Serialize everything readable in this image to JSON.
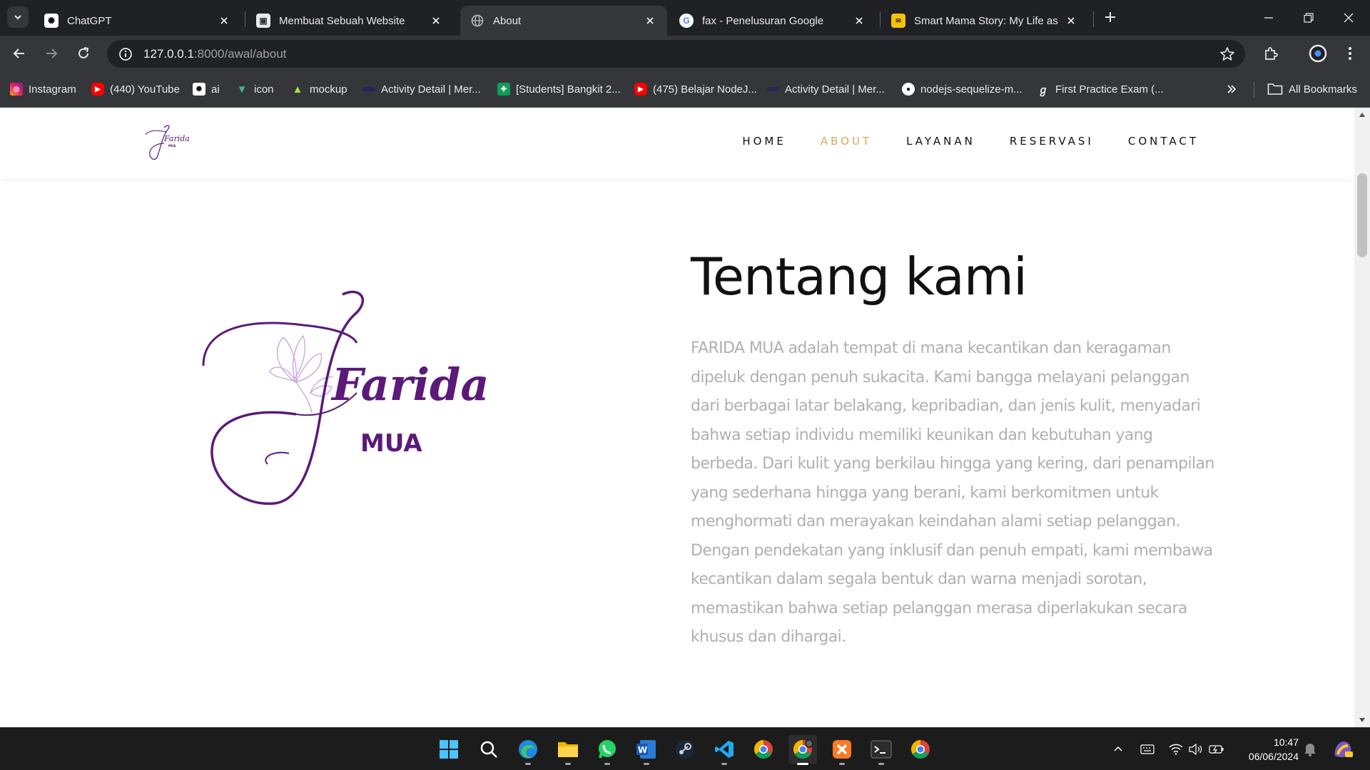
{
  "browser": {
    "tabs": [
      {
        "title": "ChatGPT",
        "icon": "chatgpt-icon"
      },
      {
        "title": "Membuat Sebuah Website",
        "icon": "classroom-icon"
      },
      {
        "title": "About",
        "icon": "globe-icon",
        "active": true
      },
      {
        "title": "fax - Penelusuran Google",
        "icon": "google-icon"
      },
      {
        "title": "Smart Mama Story: My Life as a",
        "icon": "blog-icon"
      }
    ],
    "url_host": "127.0.0.1",
    "url_path": ":8000/awal/about",
    "bookmarks": [
      {
        "label": "Instagram",
        "icon": "instagram-icon"
      },
      {
        "label": "(440) YouTube",
        "icon": "youtube-icon"
      },
      {
        "label": "ai",
        "icon": "chatgpt-icon"
      },
      {
        "label": "icon",
        "icon": "vue-icon"
      },
      {
        "label": "mockup",
        "icon": "mockup-icon"
      },
      {
        "label": "Activity Detail | Mer...",
        "icon": "activity-icon"
      },
      {
        "label": "[Students] Bangkit 2...",
        "icon": "sheets-icon"
      },
      {
        "label": "(475) Belajar NodeJ...",
        "icon": "youtube-icon"
      },
      {
        "label": "Activity Detail | Mer...",
        "icon": "activity-icon"
      },
      {
        "label": "nodejs-sequelize-m...",
        "icon": "github-icon"
      },
      {
        "label": "First Practice Exam (...",
        "icon": "exam-icon"
      }
    ],
    "all_bookmarks": "All Bookmarks"
  },
  "site": {
    "logo_script": "Farida",
    "logo_sub": "MUA",
    "nav": [
      {
        "label": "HOME",
        "active": false
      },
      {
        "label": "ABOUT",
        "active": true
      },
      {
        "label": "LAYANAN",
        "active": false
      },
      {
        "label": "RESERVASI",
        "active": false
      },
      {
        "label": "CONTACT",
        "active": false
      }
    ],
    "about_title": "Tentang kami",
    "about_text": "FARIDA MUA adalah tempat di mana kecantikan dan keragaman dipeluk dengan penuh sukacita. Kami bangga melayani pelanggan dari berbagai latar belakang, kepribadian, dan jenis kulit, menyadari bahwa setiap individu memiliki keunikan dan kebutuhan yang berbeda. Dari kulit yang berkilau hingga yang kering, dari penampilan yang sederhana hingga yang berani, kami berkomitmen untuk menghormati dan merayakan keindahan alami setiap pelanggan. Dengan pendekatan yang inklusif dan penuh empati, kami membawa kecantikan dalam segala bentuk dan warna menjadi sorotan, memastikan bahwa setiap pelanggan merasa diperlakukan secara khusus dan dihargai."
  },
  "colors": {
    "accent_nav": "#d6a85c",
    "logo_purple": "#5b1a7a",
    "flower_lilac": "#c9a0dc"
  },
  "taskbar": {
    "apps": [
      "windows-start-icon",
      "search-icon",
      "edge-icon",
      "file-explorer-icon",
      "whatsapp-icon",
      "word-icon",
      "steam-icon",
      "vscode-icon",
      "chrome-icon",
      "chrome-profile-icon",
      "xampp-icon",
      "terminal-icon",
      "chrome-icon"
    ],
    "time": "10:47",
    "date": "06/06/2024"
  }
}
